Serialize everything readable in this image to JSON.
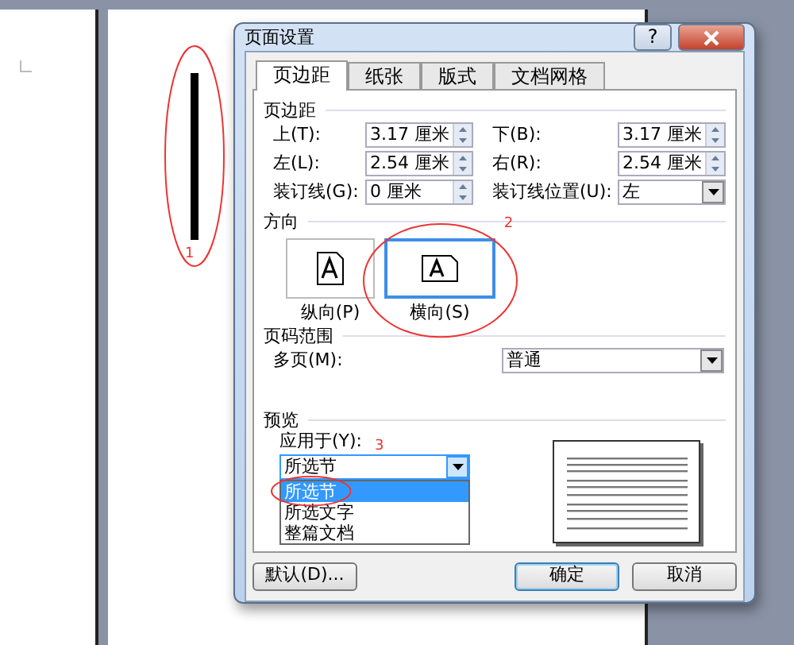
{
  "dialog": {
    "title": "页面设置",
    "help_button": "?",
    "tabs": [
      {
        "label": "页边距",
        "selected": true
      },
      {
        "label": "纸张",
        "selected": false
      },
      {
        "label": "版式",
        "selected": false
      },
      {
        "label": "文档网格",
        "selected": false
      }
    ],
    "margins": {
      "title": "页边距",
      "rows": [
        [
          {
            "label": "上(T):",
            "value": "3.17 厘米",
            "kind": "spin"
          },
          {
            "label": "下(B):",
            "value": "3.17 厘米",
            "kind": "spin"
          }
        ],
        [
          {
            "label": "左(L):",
            "value": "2.54 厘米",
            "kind": "spin"
          },
          {
            "label": "右(R):",
            "value": "2.54 厘米",
            "kind": "spin"
          }
        ],
        [
          {
            "label": "装订线(G):",
            "value": "0 厘米",
            "kind": "spin"
          },
          {
            "label": "装订线位置(U):",
            "value": "左",
            "kind": "dropdown"
          }
        ]
      ]
    },
    "orientation": {
      "title": "方向",
      "options": [
        {
          "label": "纵向(P)",
          "kind": "portrait",
          "selected": false
        },
        {
          "label": "横向(S)",
          "kind": "landscape",
          "selected": true
        }
      ]
    },
    "pages": {
      "title": "页码范围",
      "label": "多页(M):",
      "value": "普通"
    },
    "preview": {
      "title": "预览",
      "apply_label": "应用于(Y):",
      "apply_value": "所选节",
      "expanded": true,
      "options": [
        {
          "label": "所选节",
          "selected": true
        },
        {
          "label": "所选文字",
          "selected": false
        },
        {
          "label": "整篇文档",
          "selected": false
        }
      ]
    },
    "buttons": [
      {
        "label": "默认(D)...",
        "default": false
      },
      {
        "label": "确定",
        "default": true
      },
      {
        "label": "取消",
        "default": false
      }
    ]
  },
  "annotations": [
    {
      "label": "1"
    },
    {
      "label": "2"
    },
    {
      "label": "3"
    }
  ]
}
